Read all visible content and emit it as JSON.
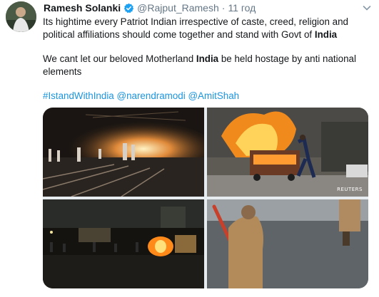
{
  "tweet": {
    "author_name": "Ramesh Solanki",
    "handle": "@Rajput_Ramesh",
    "separator": "·",
    "time": "11 год",
    "paragraph1_a": "Its hightime every Patriot Indian irrespective of caste, creed, religion and political affiliations should come together and stand with Govt of ",
    "paragraph1_b": "India",
    "paragraph2_a": "We cant let our beloved Motherland ",
    "paragraph2_b": "India",
    "paragraph2_c": " be held hostage by anti national elements",
    "links": [
      "#IstandWithIndia",
      "@narendramodi",
      "@AmitShah"
    ],
    "link_sep": " ",
    "watermark": "REUTERS"
  },
  "colors": {
    "link": "#1b95e0",
    "verified": "#1da1f2",
    "muted": "#657786"
  },
  "icons": [
    "verified-badge-icon",
    "chevron-down-icon"
  ]
}
